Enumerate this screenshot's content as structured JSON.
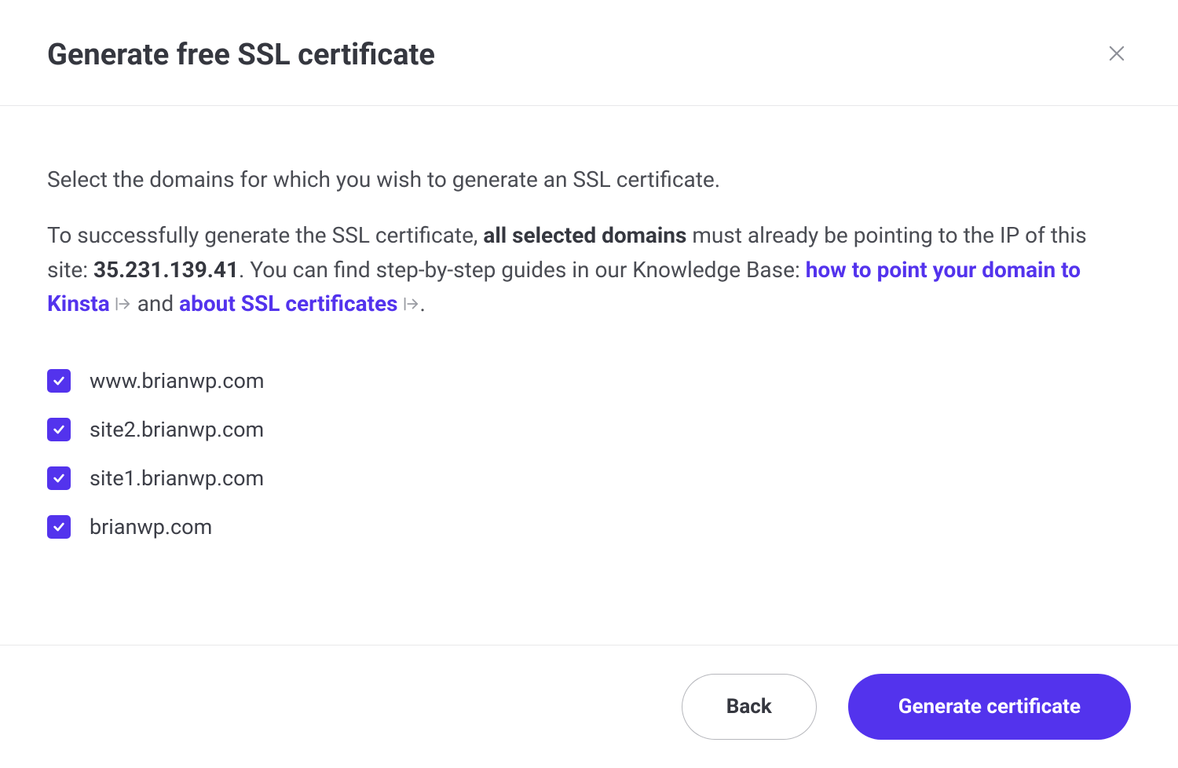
{
  "header": {
    "title": "Generate free SSL certificate"
  },
  "body": {
    "intro": "Select the domains for which you wish to generate an SSL certificate.",
    "instr_part1": "To successfully generate the SSL certificate, ",
    "instr_bold": "all selected domains",
    "instr_part2": " must already be pointing to the IP of this site: ",
    "ip": "35.231.139.41",
    "instr_part3": ". You can find step-by-step guides in our Knowledge Base: ",
    "link1": "how to point your domain to Kinsta",
    "and": " and ",
    "link2": "about SSL certificates",
    "period": "."
  },
  "domains": [
    {
      "name": "www.brianwp.com",
      "checked": true
    },
    {
      "name": "site2.brianwp.com",
      "checked": true
    },
    {
      "name": "site1.brianwp.com",
      "checked": true
    },
    {
      "name": "brianwp.com",
      "checked": true
    }
  ],
  "footer": {
    "back": "Back",
    "generate": "Generate certificate"
  }
}
